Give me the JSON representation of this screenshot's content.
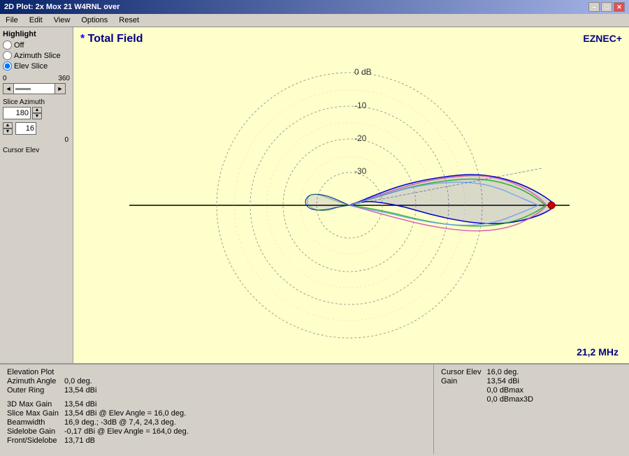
{
  "window": {
    "title": "2D Plot: 2x Mox 21 W4RNL over",
    "close_btn": "✕",
    "min_btn": "–",
    "max_btn": "□"
  },
  "menu": {
    "items": [
      "File",
      "Edit",
      "View",
      "Options",
      "Reset"
    ]
  },
  "sidebar": {
    "highlight_label": "Highlight",
    "radio_off": "Off",
    "radio_azimuth": "Azimuth Slice",
    "radio_elev": "Elev Slice",
    "selected": "elev",
    "slider_min": "0",
    "slider_max": "360",
    "slice_azimuth_label": "Slice Azimuth",
    "azimuth_value": "180",
    "cursor_elev_label": "Cursor Elev",
    "spin_value": "16",
    "spin_min": "0"
  },
  "plot": {
    "title": "* Total Field",
    "brand": "EZNEC+",
    "freq": "21,2 MHz",
    "rings": [
      "0 dB",
      "-10",
      "-20",
      "-30"
    ],
    "accent_color": "#0000cc"
  },
  "status": {
    "left": {
      "elevation_plot_label": "Elevation Plot",
      "elevation_plot_value": "",
      "azimuth_angle_label": "Azimuth Angle",
      "azimuth_angle_value": "0,0 deg.",
      "outer_ring_label": "Outer Ring",
      "outer_ring_value": "13,54 dBi",
      "gap": "",
      "max_gain_label": "3D Max Gain",
      "max_gain_value": "13,54 dBi",
      "slice_max_label": "Slice Max Gain",
      "slice_max_value": "13,54 dBi @ Elev Angle = 16,0 deg.",
      "beamwidth_label": "Beamwidth",
      "beamwidth_value": "16,9 deg.; -3dB @ 7,4, 24,3 deg.",
      "sidelobe_label": "Sidelobe Gain",
      "sidelobe_value": "-0,17 dBi @ Elev Angle = 164,0 deg.",
      "front_sidelobe_label": "Front/Sidelobe",
      "front_sidelobe_value": "13,71 dB"
    },
    "right": {
      "cursor_elev_label": "Cursor Elev",
      "cursor_elev_value": "16,0 deg.",
      "gain_label": "Gain",
      "gain_value": "13,54 dBi",
      "dbmax_label": "",
      "dbmax_value": "0,0 dBmax",
      "dbmax3d_label": "",
      "dbmax3d_value": "0,0 dBmax3D"
    }
  }
}
